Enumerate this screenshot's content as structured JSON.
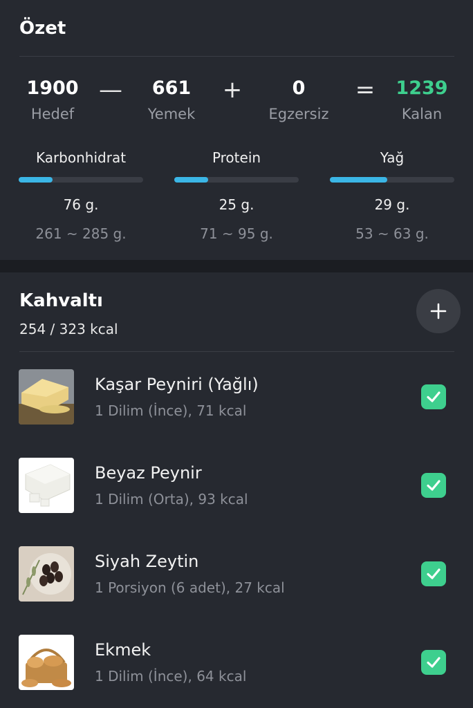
{
  "summary": {
    "title": "Özet",
    "goal": {
      "value": "1900",
      "label": "Hedef"
    },
    "minus": "—",
    "food": {
      "value": "661",
      "label": "Yemek"
    },
    "plus": "+",
    "exercise": {
      "value": "0",
      "label": "Egzersiz"
    },
    "equals": "=",
    "remaining": {
      "value": "1239",
      "label": "Kalan",
      "color": "#3ecf8e"
    },
    "macros": [
      {
        "name": "Karbonhidrat",
        "value": "76 g.",
        "range": "261 ~ 285 g.",
        "progress": 0.27
      },
      {
        "name": "Protein",
        "value": "25 g.",
        "range": "71 ~ 95 g.",
        "progress": 0.27
      },
      {
        "name": "Yağ",
        "value": "29 g.",
        "range": "53 ~ 63 g.",
        "progress": 0.46
      }
    ],
    "bar_color": "#3bb6e6"
  },
  "meal": {
    "title": "Kahvaltı",
    "kcal": "254 / 323 kcal",
    "add_icon": "plus-icon",
    "items": [
      {
        "name": "Kaşar Peyniri (Yağlı)",
        "desc": "1 Dilim (İnce), 71 kcal",
        "icon": "cheese-image",
        "checked": true
      },
      {
        "name": "Beyaz Peynir",
        "desc": "1 Dilim (Orta), 93 kcal",
        "icon": "white-cheese-image",
        "checked": true
      },
      {
        "name": "Siyah Zeytin",
        "desc": "1 Porsiyon (6 adet), 27 kcal",
        "icon": "olives-image",
        "checked": true
      },
      {
        "name": "Ekmek",
        "desc": "1 Dilim (İnce), 64 kcal",
        "icon": "bread-image",
        "checked": true
      }
    ],
    "check_color": "#3ecf8e"
  }
}
